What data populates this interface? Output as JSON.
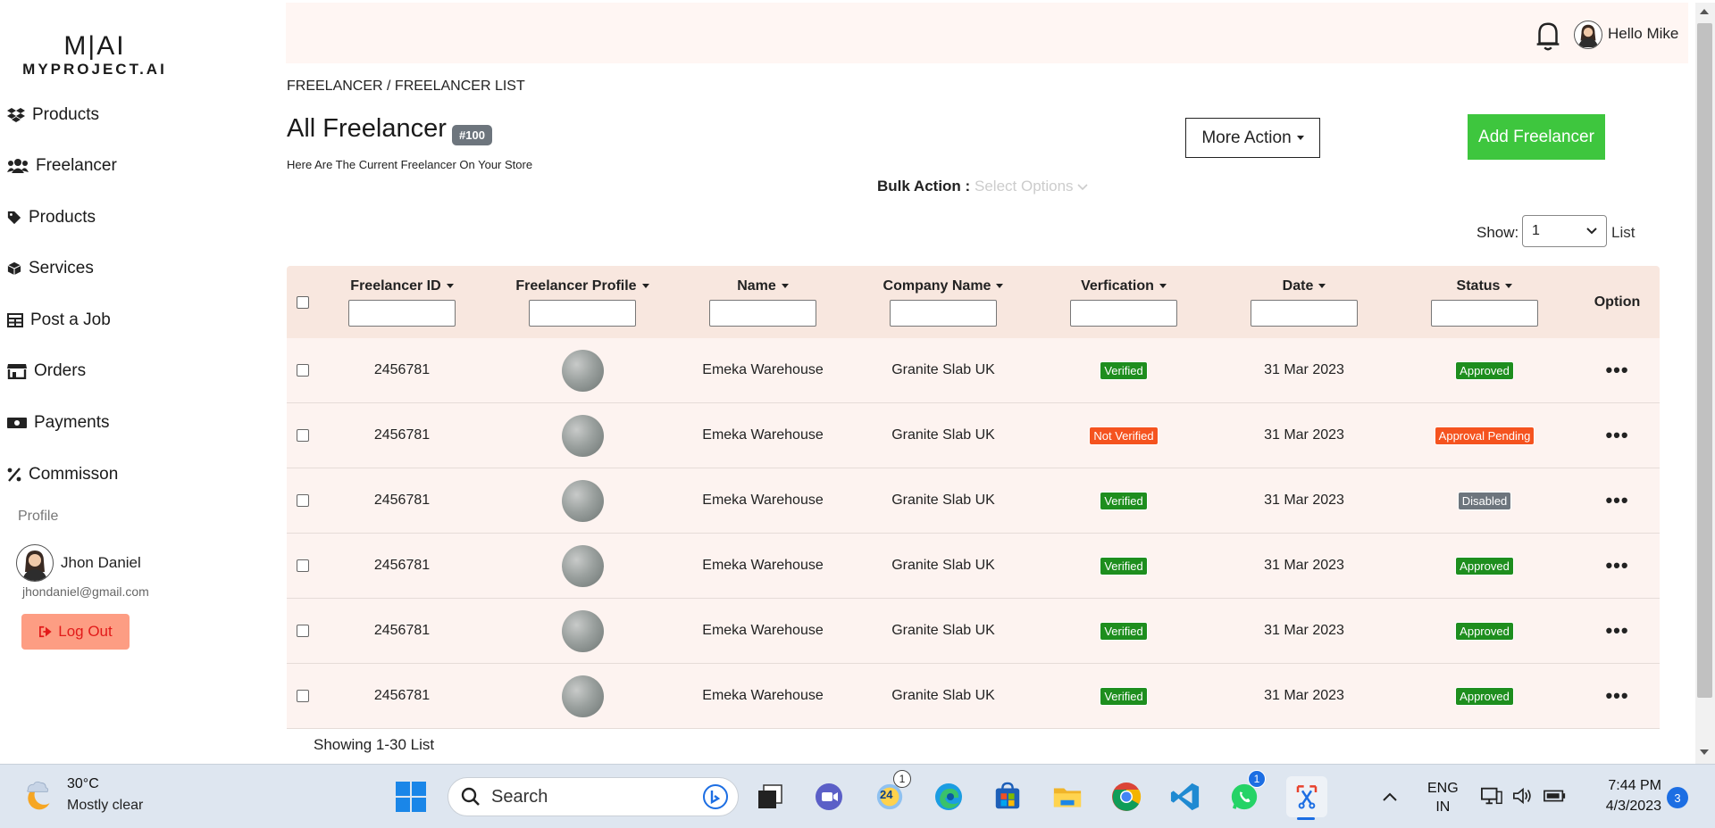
{
  "brand": {
    "mark": "M|AI",
    "name": "MYPROJECT.AI"
  },
  "sidebar": {
    "items": [
      {
        "label": "Products",
        "icon": "dropbox-icon"
      },
      {
        "label": "Freelancer",
        "icon": "users-icon"
      },
      {
        "label": "Products",
        "icon": "tag-icon"
      },
      {
        "label": "Services",
        "icon": "box-icon"
      },
      {
        "label": "Post a Job",
        "icon": "table-icon"
      },
      {
        "label": "Orders",
        "icon": "store-icon"
      },
      {
        "label": "Payments",
        "icon": "money-icon"
      },
      {
        "label": "Commisson",
        "icon": "percent-icon"
      }
    ],
    "profile_label": "Profile",
    "user_name": "Jhon Daniel",
    "user_email": "jhondaniel@gmail.com",
    "logout_label": "Log Out"
  },
  "header": {
    "greeting": "Hello Mike"
  },
  "breadcrumb": "FREELANCER / FREELANCER LIST",
  "page": {
    "title": "All Freelancer",
    "count": "#100",
    "subtitle": "Here Are The Current Freelancer On Your Store",
    "more_action": "More Action",
    "add_button": "Add Freelancer",
    "bulk_label": "Bulk Action :",
    "bulk_placeholder": "Select Options",
    "show_label": "Show:",
    "show_value": "1",
    "list_label": "List",
    "showing": "Showing 1-30 List"
  },
  "table": {
    "columns": [
      "Freelancer ID",
      "Freelancer Profile",
      "Name",
      "Company Name",
      "Verfication",
      "Date",
      "Status",
      "Option"
    ],
    "rows": [
      {
        "id": "2456781",
        "name": "Emeka Warehouse",
        "company": "Granite Slab UK",
        "verification": "Verified",
        "date": "31 Mar 2023",
        "status": "Approved"
      },
      {
        "id": "2456781",
        "name": "Emeka Warehouse",
        "company": "Granite Slab UK",
        "verification": "Not Verified",
        "date": "31 Mar 2023",
        "status": "Approval Pending"
      },
      {
        "id": "2456781",
        "name": "Emeka Warehouse",
        "company": "Granite Slab UK",
        "verification": "Verified",
        "date": "31 Mar 2023",
        "status": "Disabled"
      },
      {
        "id": "2456781",
        "name": "Emeka Warehouse",
        "company": "Granite Slab UK",
        "verification": "Verified",
        "date": "31 Mar 2023",
        "status": "Approved"
      },
      {
        "id": "2456781",
        "name": "Emeka Warehouse",
        "company": "Granite Slab UK",
        "verification": "Verified",
        "date": "31 Mar 2023",
        "status": "Approved"
      },
      {
        "id": "2456781",
        "name": "Emeka Warehouse",
        "company": "Granite Slab UK",
        "verification": "Verified",
        "date": "31 Mar 2023",
        "status": "Approved"
      }
    ],
    "option_glyph": "•••"
  },
  "colors": {
    "verified": "#1e8e1e",
    "not_verified": "#f5531f",
    "approved": "#1e8e1e",
    "approval_pending": "#f5531f",
    "disabled": "#6d757d",
    "add_button": "#3ec63e",
    "logout_bg": "#fd9d83"
  },
  "taskbar": {
    "weather_temp": "30°C",
    "weather_desc": "Mostly clear",
    "search_placeholder": "Search",
    "lang_1": "ENG",
    "lang_2": "IN",
    "time": "7:44 PM",
    "date": "4/3/2023",
    "notifications": "3",
    "calendar_day": "24",
    "calendar_badge": "1",
    "whatsapp_badge": "1"
  }
}
